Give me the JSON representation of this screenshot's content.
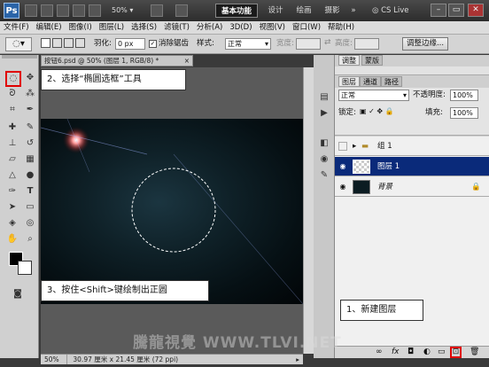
{
  "titlebar": {
    "logo": "Ps",
    "zoom": "50%",
    "workspaces": [
      "基本功能",
      "设计",
      "绘画",
      "摄影"
    ],
    "more": "»",
    "cs_live": "CS Live",
    "win_controls": [
      "–",
      "▭",
      "✕"
    ]
  },
  "menu": [
    "文件(F)",
    "编辑(E)",
    "图像(I)",
    "图层(L)",
    "选择(S)",
    "滤镜(T)",
    "分析(A)",
    "3D(D)",
    "视图(V)",
    "窗口(W)",
    "帮助(H)"
  ],
  "options": {
    "feather_label": "羽化:",
    "feather_value": "0 px",
    "antialias_label": "消除锯齿",
    "style_label": "样式:",
    "style_value": "正常",
    "width_label": "宽度:",
    "height_label": "高度:",
    "refine_button": "调整边缘..."
  },
  "document": {
    "tab_title": "按钮6.psd @ 50% (图层 1, RGB/8) *",
    "status_zoom": "50%",
    "status_info": "30.97 厘米 x 21.45 厘米 (72 ppi)"
  },
  "callouts": {
    "step2": "2、选择“椭圆选框”工具",
    "step3": "3、按住<Shift>键绘制出正圆",
    "step1": "1、新建图层"
  },
  "panel": {
    "top_tabs": [
      "调整",
      "蒙版"
    ],
    "tabs": [
      "图层",
      "通道",
      "路径"
    ],
    "blend_mode": "正常",
    "opacity_label": "不透明度:",
    "opacity_value": "100%",
    "lock_label": "锁定:",
    "fill_label": "填充:",
    "fill_value": "100%",
    "layers": [
      {
        "name": "组 1"
      },
      {
        "name": "图层 1"
      },
      {
        "name": "背景"
      }
    ],
    "bottom_icons": [
      "link-icon",
      "fx-icon",
      "mask-icon",
      "adjustment-icon",
      "folder-icon",
      "new-layer-icon",
      "trash-icon"
    ]
  },
  "watermark": "騰龍視覺 WWW.TLVI.NET",
  "colors": {
    "selected_layer": "#0a2a7a",
    "callout_highlight": "#e00000"
  }
}
